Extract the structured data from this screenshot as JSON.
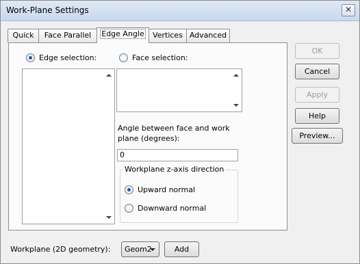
{
  "window": {
    "title": "Work-Plane Settings",
    "close_glyph": "✕"
  },
  "tabs": [
    {
      "label": "Quick"
    },
    {
      "label": "Face Parallel"
    },
    {
      "label": "Edge Angle"
    },
    {
      "label": "Vertices"
    },
    {
      "label": "Advanced"
    }
  ],
  "panel": {
    "edge_selection_label": "Edge selection:",
    "face_selection_label": "Face selection:",
    "angle_label_line1": "Angle between face and work",
    "angle_label_line2": "plane (degrees):",
    "angle_value": "0",
    "zaxis_group_title": "Workplane z-axis direction",
    "upward_label": "Upward normal",
    "downward_label": "Downward normal"
  },
  "buttons": {
    "ok": "OK",
    "cancel": "Cancel",
    "apply": "Apply",
    "help": "Help",
    "preview": "Preview..."
  },
  "footer": {
    "workplane_label": "Workplane (2D geometry):",
    "geom_value": "Geom2",
    "add_label": "Add"
  }
}
